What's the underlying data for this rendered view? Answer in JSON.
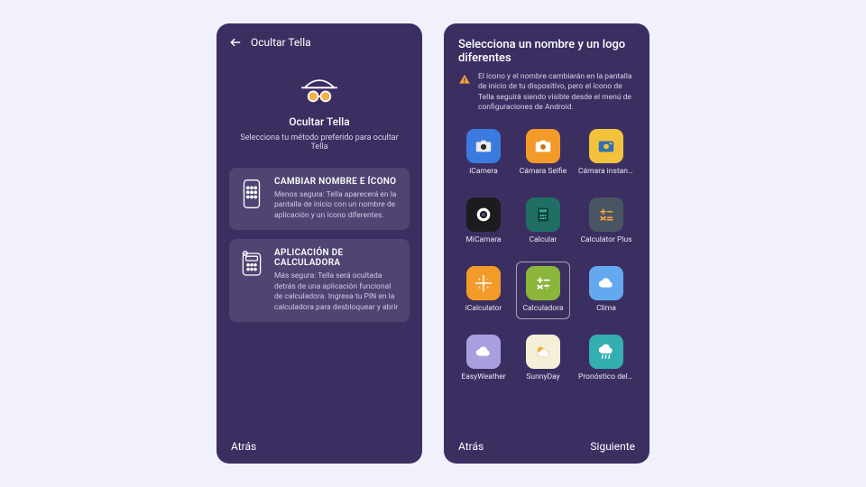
{
  "left": {
    "header_title": "Ocultar Tella",
    "hero_title": "Ocultar Tella",
    "hero_sub": "Selecciona tu método preferido para ocultar Tella",
    "card1_title": "CAMBIAR NOMBRE E ÍCONO",
    "card1_desc": "Menos segura: Tella aparecerá en la pantalla de inicio con un nombre de aplicación y un ícono diferentes.",
    "card2_title": "APLICACIÓN DE CALCULADORA",
    "card2_desc": "Más segura: Tella será ocultada detrás de una aplicación funcional de calculadora. Ingresa tu PIN en la calculadora para desbloquear y abrir",
    "back_label": "Atrás"
  },
  "right": {
    "title": "Selecciona un nombre y un logo diferentes",
    "warning": "El ícono y el nombre cambiarán en la pantalla de inicio de tu dispositivo, pero el ícono de Tella seguirá siendo visible desde el menú de configuraciones de Android.",
    "apps": [
      {
        "label": "iCamera"
      },
      {
        "label": "Cámara Selfie"
      },
      {
        "label": "Cámara instantánea"
      },
      {
        "label": "MiCamara"
      },
      {
        "label": "Calcular"
      },
      {
        "label": "Calculator Plus"
      },
      {
        "label": "iCalculator"
      },
      {
        "label": "Calculadora"
      },
      {
        "label": "Clima"
      },
      {
        "label": "EasyWeather"
      },
      {
        "label": "SunnyDay"
      },
      {
        "label": "Pronóstico del tiempo"
      }
    ],
    "selected_index": 7,
    "back_label": "Atrás",
    "next_label": "Siguiente"
  }
}
